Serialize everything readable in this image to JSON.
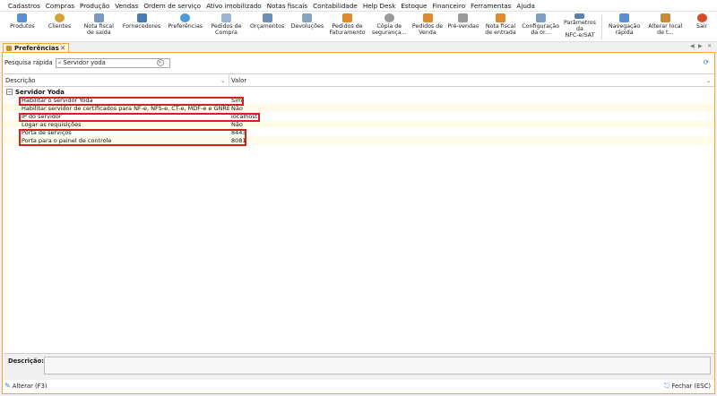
{
  "menubar": {
    "items": [
      "Cadastros",
      "Compras",
      "Produção",
      "Vendas",
      "Ordem de serviço",
      "Ativo imobilizado",
      "Notas fiscais",
      "Contabilidade",
      "Help Desk",
      "Estoque",
      "Financeiro",
      "Ferramentas",
      "Ajuda"
    ]
  },
  "toolbar": {
    "produtos": {
      "label": "Produtos",
      "icon": "box-icon",
      "color": "#5b8fd1"
    },
    "clientes": {
      "label": "Clientes",
      "icon": "person-icon",
      "color": "#d7a23c"
    },
    "nota_saida": {
      "label": "Nota fiscal\nde saída",
      "icon": "invoice-out-icon",
      "color": "#7b9ac0"
    },
    "fornecedores": {
      "label": "Fornecedores",
      "icon": "supplier-icon",
      "color": "#4a7ab8"
    },
    "preferencias": {
      "label": "Preferências",
      "icon": "settings-icon",
      "color": "#4a9bd6"
    },
    "pedidos_compra": {
      "label": "Pedidos de\nCompra",
      "icon": "purchase-order-icon",
      "color": "#9ab5d6"
    },
    "orcamentos": {
      "label": "Orçamentos",
      "icon": "quote-icon",
      "color": "#6e8fb5"
    },
    "devolucoes": {
      "label": "Devoluções",
      "icon": "return-icon",
      "color": "#8aa3c0"
    },
    "pedidos_faturamento": {
      "label": "Pedidos de\nFaturamento",
      "icon": "billing-icon",
      "color": "#e08a2e"
    },
    "copia_seguranca": {
      "label": "Cópia de\nsegurança...",
      "icon": "backup-icon",
      "color": "#9a9a9a"
    },
    "pedidos_venda": {
      "label": "Pedidos de\nVenda",
      "icon": "sales-order-icon",
      "color": "#e08a2e"
    },
    "pre_vendas": {
      "label": "Pré-vendas",
      "icon": "cart-icon",
      "color": "#9a9a9a"
    },
    "nota_entrada": {
      "label": "Nota fiscal\nde entrada",
      "icon": "invoice-in-icon",
      "color": "#e08a2e"
    },
    "configuracao": {
      "label": "Configuração\nda or...",
      "icon": "config-icon",
      "color": "#7f9fc4"
    },
    "parametros": {
      "label": "Parâmetros\nda\nNFC-e/SAT",
      "icon": "parameters-icon",
      "color": "#5b7fb0"
    },
    "navegacao": {
      "label": "Navegação\nrápida",
      "icon": "navigation-icon",
      "color": "#5b8fd1"
    },
    "alterar_local": {
      "label": "Alterar local\nde t...",
      "icon": "location-icon",
      "color": "#c98a3a"
    },
    "sair": {
      "label": "Sair",
      "icon": "exit-icon",
      "color": "#d94a2a"
    }
  },
  "tab": {
    "label": "Preferências",
    "close": "✕"
  },
  "search": {
    "label": "Pesquisa rápida",
    "value": "Servidor yoda",
    "placeholder": ""
  },
  "grid": {
    "col_desc": "Descrição",
    "col_val": "Valor",
    "group": "Servidor Yoda",
    "rows": [
      {
        "desc": "Habilitar o servidor Yoda",
        "val": "Sim"
      },
      {
        "desc": "Habilitar servidor de certificados para NF-e, NFS-e, CT-e, MDF-e e GNRE",
        "val": "Não"
      },
      {
        "desc": "IP do servidor",
        "val": "localhost"
      },
      {
        "desc": "Logar as requisições",
        "val": "Não"
      },
      {
        "desc": "Porta de serviços",
        "val": "8443"
      },
      {
        "desc": "Porta para o painel de controle",
        "val": "8081"
      }
    ]
  },
  "description": {
    "label": "Descrição:",
    "value": ""
  },
  "footer": {
    "edit": "Alterar (F3)",
    "close": "Fechar (ESC)"
  },
  "colors": {
    "accent": "#f0a830",
    "highlight": "#d62020",
    "tab_bg": "#fff3d6"
  }
}
